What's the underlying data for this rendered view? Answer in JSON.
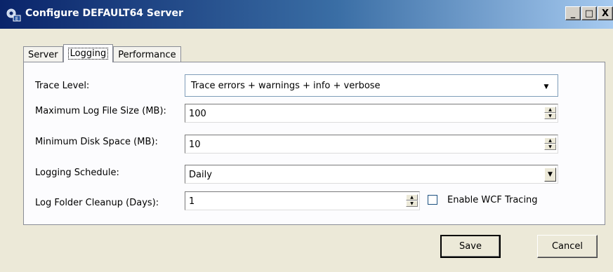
{
  "window": {
    "title": "Configure DEFAULT64 Server",
    "minimize_glyph": "_",
    "maximize_glyph": "□",
    "close_glyph": "X"
  },
  "tabs": [
    {
      "label": "Server",
      "active": false
    },
    {
      "label": "Logging",
      "active": true
    },
    {
      "label": "Performance",
      "active": false
    }
  ],
  "logging": {
    "trace_level": {
      "label": "Trace Level:",
      "value": "Trace errors + warnings + info + verbose"
    },
    "max_log_size": {
      "label": "Maximum Log File Size (MB):",
      "value": "100"
    },
    "min_disk_space": {
      "label": "Minimum Disk Space (MB):",
      "value": "10"
    },
    "schedule": {
      "label": "Logging Schedule:",
      "value": "Daily"
    },
    "cleanup": {
      "label": "Log Folder Cleanup (Days):",
      "value": "1"
    },
    "wcf_tracing": {
      "label": "Enable WCF Tracing",
      "checked": false
    }
  },
  "buttons": {
    "save": "Save",
    "cancel": "Cancel"
  }
}
